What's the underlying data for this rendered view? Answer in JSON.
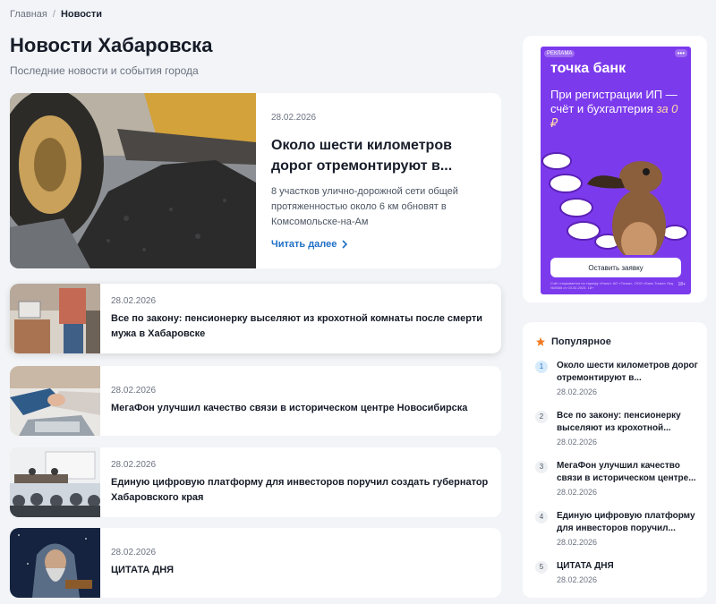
{
  "breadcrumb": {
    "home": "Главная",
    "separator": "/",
    "current": "Новости"
  },
  "page": {
    "title": "Новости Хабаровска",
    "subtitle": "Последние новости и события города"
  },
  "featured": {
    "date": "28.02.2026",
    "title": "Около шести километров дорог отремонтируют в...",
    "lead": "8 участков улично-дорожной сети общей протяженностью около 6 км обновят в Комсомольске-на-Ам",
    "read_more": "Читать далее",
    "image_icon": "asphalt-paving-photo"
  },
  "news": [
    {
      "date": "28.02.2026",
      "title": "Все по закону: пенсионерку выселяют из крохотной комнаты после смерти мужа в Хабаровске",
      "image_icon": "small-room-photo"
    },
    {
      "date": "28.02.2026",
      "title": "МегаФон улучшил качество связи в историческом центре Новосибирска",
      "image_icon": "handshake-laptop-photo"
    },
    {
      "date": "28.02.2026",
      "title": "Единую цифровую платформу для инвесторов поручил создать губернатор Хабаровского края",
      "image_icon": "conference-hall-photo"
    },
    {
      "date": "28.02.2026",
      "title": "ЦИТАТА ДНЯ",
      "image_icon": "old-sage-photo"
    }
  ],
  "ad": {
    "badge": "РЕКЛАМА",
    "brand": "точка банк",
    "headline": "При регистрации ИП — счёт и бухгалтерия",
    "price": "за 0 ₽",
    "button": "Оставить заявку",
    "legal": "Счёт открывается по тарифу «Ноль» АО «Точка», ООО «Банк Точка» Лиц. №3565 от 03.02.2023. 18+",
    "age": "18+",
    "colors": {
      "background": "#7c3aed",
      "accent": "#ffd7a8"
    }
  },
  "popular": {
    "title": "Популярное",
    "icon": "star-icon",
    "items": [
      {
        "num": "1",
        "title": "Около шести километров дорог отремонтируют в...",
        "date": "28.02.2026"
      },
      {
        "num": "2",
        "title": "Все по закону: пенсионерку выселяют из крохотной...",
        "date": "28.02.2026"
      },
      {
        "num": "3",
        "title": "МегаФон улучшил качество связи в историческом центре...",
        "date": "28.02.2026"
      },
      {
        "num": "4",
        "title": "Единую цифровую платформу для инвесторов поручил...",
        "date": "28.02.2026"
      },
      {
        "num": "5",
        "title": "ЦИТАТА ДНЯ",
        "date": "28.02.2026"
      }
    ]
  }
}
